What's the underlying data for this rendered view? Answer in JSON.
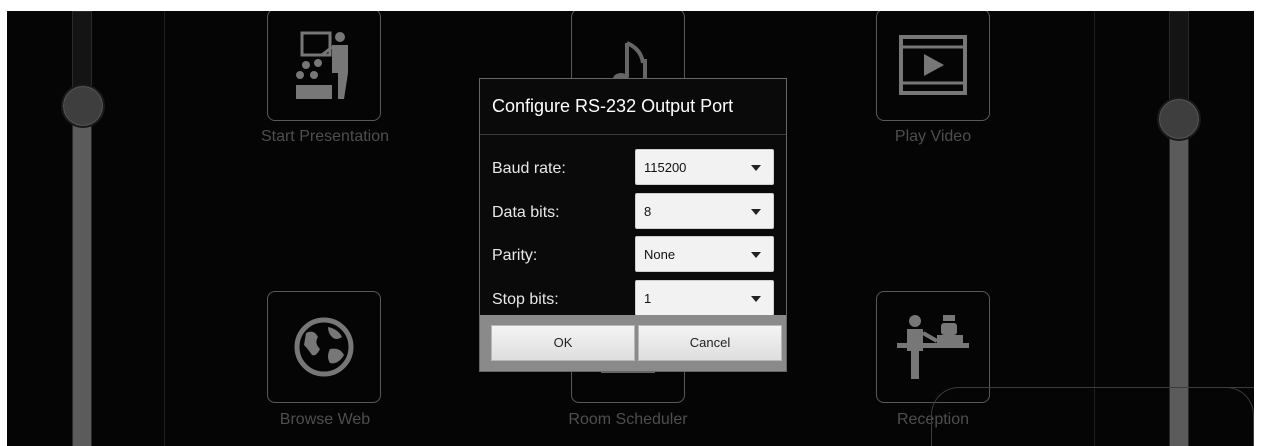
{
  "tiles": [
    {
      "label": "Start Presentation",
      "icon": "presentation-icon"
    },
    {
      "label": "",
      "icon": "music-icon"
    },
    {
      "label": "Play Video",
      "icon": "video-icon"
    },
    {
      "label": "Browse Web",
      "icon": "globe-icon"
    },
    {
      "label": "Room Scheduler",
      "icon": "scheduler-icon"
    },
    {
      "label": "Reception",
      "icon": "reception-icon"
    }
  ],
  "dialog": {
    "title": "Configure RS-232 Output Port",
    "fields": [
      {
        "label": "Baud rate:",
        "value": "115200"
      },
      {
        "label": "Data bits:",
        "value": "8"
      },
      {
        "label": "Parity:",
        "value": "None"
      },
      {
        "label": "Stop bits:",
        "value": "1"
      }
    ],
    "ok_label": "OK",
    "cancel_label": "Cancel"
  },
  "colors": {
    "background": "#050505",
    "dialog_text": "#ffffff",
    "tile_label": "#4e4e4e",
    "button_bar": "#8a8a8a"
  }
}
